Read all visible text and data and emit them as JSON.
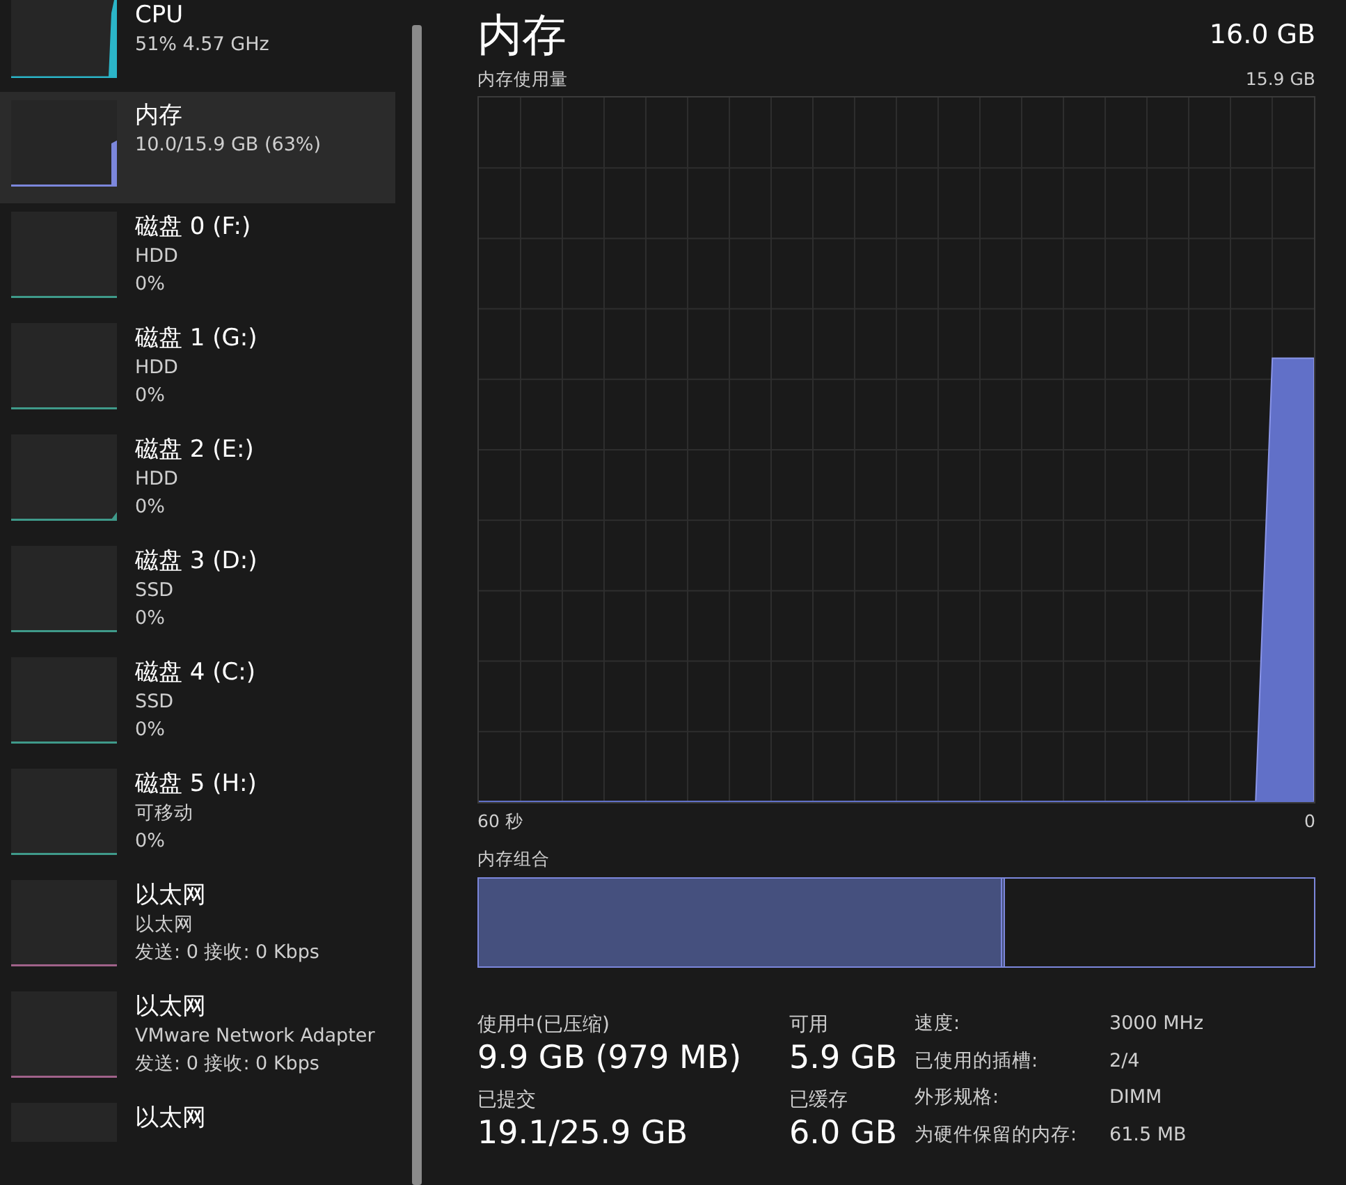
{
  "sidebar": {
    "items": [
      {
        "title": "CPU",
        "lines": [
          "51% 4.57 GHz"
        ],
        "color": "#2bb5c8",
        "selected": false
      },
      {
        "title": "内存",
        "lines": [
          "10.0/15.9 GB (63%)"
        ],
        "color": "#7c87dc",
        "selected": true
      },
      {
        "title": "磁盘 0 (F:)",
        "lines": [
          "HDD",
          "0%"
        ],
        "color": "#3f9a8a",
        "selected": false
      },
      {
        "title": "磁盘 1 (G:)",
        "lines": [
          "HDD",
          "0%"
        ],
        "color": "#3f9a8a",
        "selected": false
      },
      {
        "title": "磁盘 2 (E:)",
        "lines": [
          "HDD",
          "0%"
        ],
        "color": "#3f9a8a",
        "selected": false
      },
      {
        "title": "磁盘 3 (D:)",
        "lines": [
          "SSD",
          "0%"
        ],
        "color": "#3f9a8a",
        "selected": false
      },
      {
        "title": "磁盘 4 (C:)",
        "lines": [
          "SSD",
          "0%"
        ],
        "color": "#3f9a8a",
        "selected": false
      },
      {
        "title": "磁盘 5 (H:)",
        "lines": [
          "可移动",
          "0%"
        ],
        "color": "#3f9a8a",
        "selected": false
      },
      {
        "title": "以太网",
        "lines": [
          "以太网",
          "发送: 0 接收: 0 Kbps"
        ],
        "color": "#a0628a",
        "selected": false
      },
      {
        "title": "以太网",
        "lines": [
          "VMware Network Adapter",
          "发送: 0 接收: 0 Kbps"
        ],
        "color": "#a0628a",
        "selected": false
      },
      {
        "title": "以太网",
        "selected": false
      }
    ]
  },
  "header": {
    "title": "内存",
    "total": "16.0 GB"
  },
  "usage_graph": {
    "label": "内存使用量",
    "max": "15.9 GB",
    "x_start": "60 秒",
    "x_end": "0"
  },
  "composition": {
    "label": "内存组合",
    "level": 0.63
  },
  "stats": [
    {
      "label": "使用中(已压缩)",
      "value": "9.9 GB (979 MB)"
    },
    {
      "label": "可用",
      "value": "5.9 GB"
    },
    {
      "label": "已提交",
      "value": "19.1/25.9 GB"
    },
    {
      "label": "已缓存",
      "value": "6.0 GB"
    }
  ],
  "details": [
    {
      "label": "速度:",
      "value": "3000 MHz"
    },
    {
      "label": "已使用的插槽:",
      "value": "2/4"
    },
    {
      "label": "外形规格:",
      "value": "DIMM"
    },
    {
      "label": "为硬件保留的内存:",
      "value": "61.5 MB"
    }
  ]
}
